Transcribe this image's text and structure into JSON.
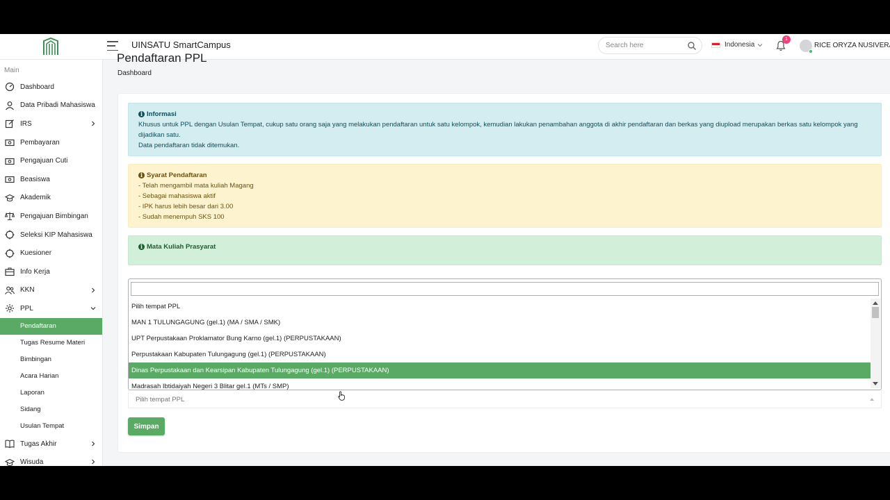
{
  "header": {
    "app_title": "UINSATU SmartCampus",
    "search_placeholder": "Search here",
    "language": "Indonesia",
    "notification_count": "1",
    "user_name": "RICE ORYZA NUSIVERA"
  },
  "sidebar": {
    "section_label": "Main",
    "items": [
      {
        "label": "Dashboard",
        "icon": "dashboard-icon"
      },
      {
        "label": "Data Pribadi Mahasiswa",
        "icon": "user-icon"
      },
      {
        "label": "IRS",
        "icon": "edit-icon",
        "expandable": true
      },
      {
        "label": "Pembayaran",
        "icon": "money-icon"
      },
      {
        "label": "Pengajuan Cuti",
        "icon": "money-icon"
      },
      {
        "label": "Beasiswa",
        "icon": "money-icon"
      },
      {
        "label": "Akademik",
        "icon": "graduation-cap-icon"
      },
      {
        "label": "Pengajuan Bimbingan",
        "icon": "scale-icon"
      },
      {
        "label": "Seleksi KIP Mahasiswa",
        "icon": "crosshair-icon"
      },
      {
        "label": "Kuesioner",
        "icon": "crosshair-icon"
      },
      {
        "label": "Info Kerja",
        "icon": "briefcase-icon"
      },
      {
        "label": "KKN",
        "icon": "users-icon",
        "expandable": true
      },
      {
        "label": "PPL",
        "icon": "gear-icon",
        "expanded": true
      }
    ],
    "ppl_sub_items": [
      {
        "label": "Pendaftaran",
        "active": true
      },
      {
        "label": "Tugas Resume Materi"
      },
      {
        "label": "Bimbingan"
      },
      {
        "label": "Acara Harian"
      },
      {
        "label": "Laporan"
      },
      {
        "label": "Sidang"
      },
      {
        "label": "Usulan Tempat"
      }
    ],
    "after_items": [
      {
        "label": "Tugas Akhir",
        "icon": "book-icon",
        "expandable": true
      },
      {
        "label": "Wisuda",
        "icon": "graduation-cap-icon",
        "expandable": true
      }
    ]
  },
  "main": {
    "page_title": "Pendaftaran PPL",
    "breadcrumb": "Dashboard",
    "info_alert": {
      "title": "Informasi",
      "lines": [
        "Khusus untuk PPL dengan Usulan Tempat, cukup satu orang saja yang melakukan pendaftaran untuk satu kelompok, kemudian lakukan penambahan anggota di akhir pendaftaran dan berkas yang diupload merupakan berkas satu kelompok yang dijadikan satu.",
        "Data pendaftaran tidak ditemukan."
      ]
    },
    "requirements_alert": {
      "title": "Syarat Pendaftaran",
      "lines": [
        "- Telah mengambil mata kuliah Magang",
        "- Sebagai mahasiswa aktif",
        "- IPK harus lebih besar dari 3.00",
        "- Sudah menempuh SKS 100"
      ]
    },
    "prereq_alert": {
      "title": "Mata Kuliah Prasyarat"
    },
    "place_select": {
      "search_value": "",
      "options": [
        "Pilih tempat PPL",
        "MAN 1 TULUNGAGUNG (gel.1) (MA / SMA / SMK)",
        "UPT Perpustakaan Proklamator Bung Karno (gel.1) (PERPUSTAKAAN)",
        "Perpustakaan Kabupaten Tulungagung (gel.1) (PERPUSTAKAAN)",
        "Dinas Perpustakaan dan Kearsipan Kabupaten Tulungagung (gel.1) (PERPUSTAKAAN)",
        "Madrasah Ibtidaiyah Negeri 3 Blitar gel.1 (MTs / SMP)"
      ],
      "highlighted_index": 4,
      "selected_label": "Pilih tempat PPL"
    },
    "save_button": "Simpan"
  },
  "colors": {
    "accent_green": "#5aaa65",
    "info_bg": "#d3edf1",
    "warning_bg": "#fdf3cf",
    "success_bg": "#d2f0d9",
    "badge": "#e8457a"
  }
}
